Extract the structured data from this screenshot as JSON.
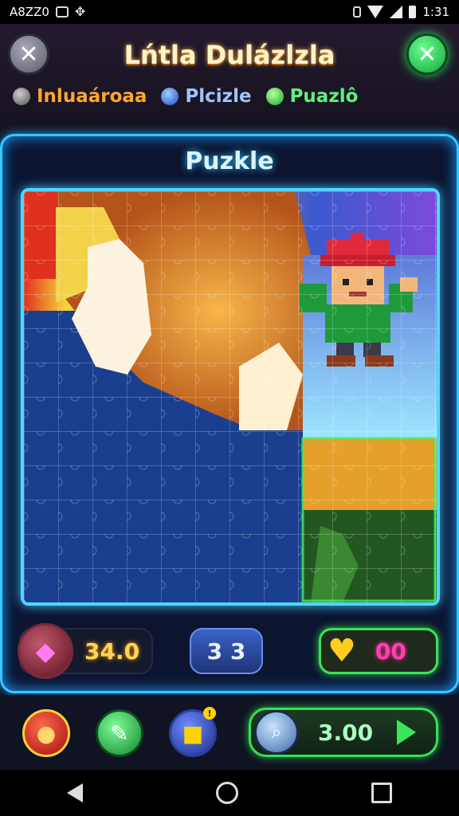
{
  "status_bar": {
    "left_text": "A8ZZ0",
    "time": "1:31",
    "icons": [
      "image-icon",
      "puzzle-icon",
      "vibrate-icon",
      "wifi-icon",
      "signal-icon",
      "battery-icon"
    ]
  },
  "header": {
    "title": "Lńtla Dulázlzla",
    "tabs": [
      {
        "label": "Inluaároaa",
        "color": "#ffa62b"
      },
      {
        "label": "Plcizle",
        "color": "#9fc4ff"
      },
      {
        "label": "Puazlô",
        "color": "#5ff07a"
      }
    ]
  },
  "panel": {
    "title": "Puzkle"
  },
  "stats": {
    "gems": "34.0",
    "level": "3 3",
    "hearts": "00"
  },
  "actions": {
    "timer": "3.00"
  },
  "colors": {
    "accent_cyan": "#36c8ff",
    "accent_green": "#36e05a"
  }
}
